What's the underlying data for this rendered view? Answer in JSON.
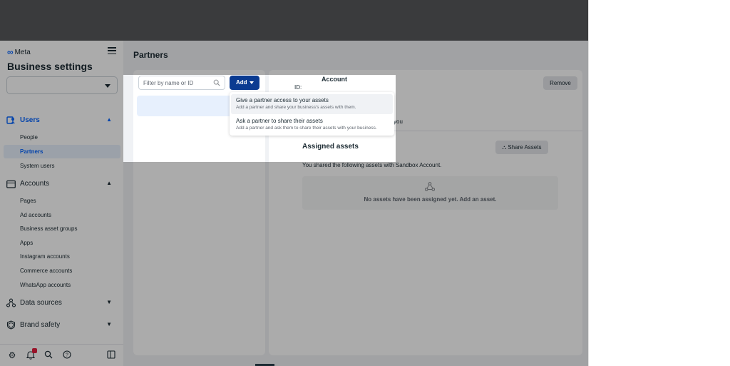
{
  "sidebar": {
    "logo": "Meta",
    "title": "Business settings",
    "users": {
      "label": "Users",
      "items": [
        "People",
        "Partners",
        "System users"
      ]
    },
    "accounts": {
      "label": "Accounts",
      "items": [
        "Pages",
        "Ad accounts",
        "Business asset groups",
        "Apps",
        "Instagram accounts",
        "Commerce accounts",
        "WhatsApp accounts"
      ]
    },
    "data_sources": "Data sources",
    "brand_safety": "Brand safety"
  },
  "main": {
    "title": "Partners",
    "filter_placeholder": "Filter by name or ID",
    "add_label": "Add",
    "account_heading": "Account",
    "account_id_label": "ID:",
    "remove_label": "Remove",
    "you_text": "you",
    "assigned_title": "Assigned assets",
    "share_label": "Share Assets",
    "shared_text": "You shared the following assets with Sandbox Account.",
    "empty_text": "No assets have been assigned yet. Add an asset."
  },
  "dropdown": {
    "options": [
      {
        "title": "Give a partner access to your assets",
        "desc": "Add a partner and share your business's assets with them."
      },
      {
        "title": "Ask a partner to share their assets",
        "desc": "Add a partner and ask them to share their assets with your business."
      }
    ]
  },
  "icons": {
    "users": "users-icon",
    "accounts": "briefcase-icon",
    "data_sources": "data-sources-icon",
    "brand_safety": "shield-icon",
    "settings": "gear-icon",
    "notifications": "bell-icon",
    "search": "search-icon",
    "help": "help-icon",
    "panel": "panel-toggle-icon"
  },
  "colors": {
    "accent": "#0866ff",
    "add_button": "#0b3b91",
    "topbar": "#3a3b3d"
  }
}
